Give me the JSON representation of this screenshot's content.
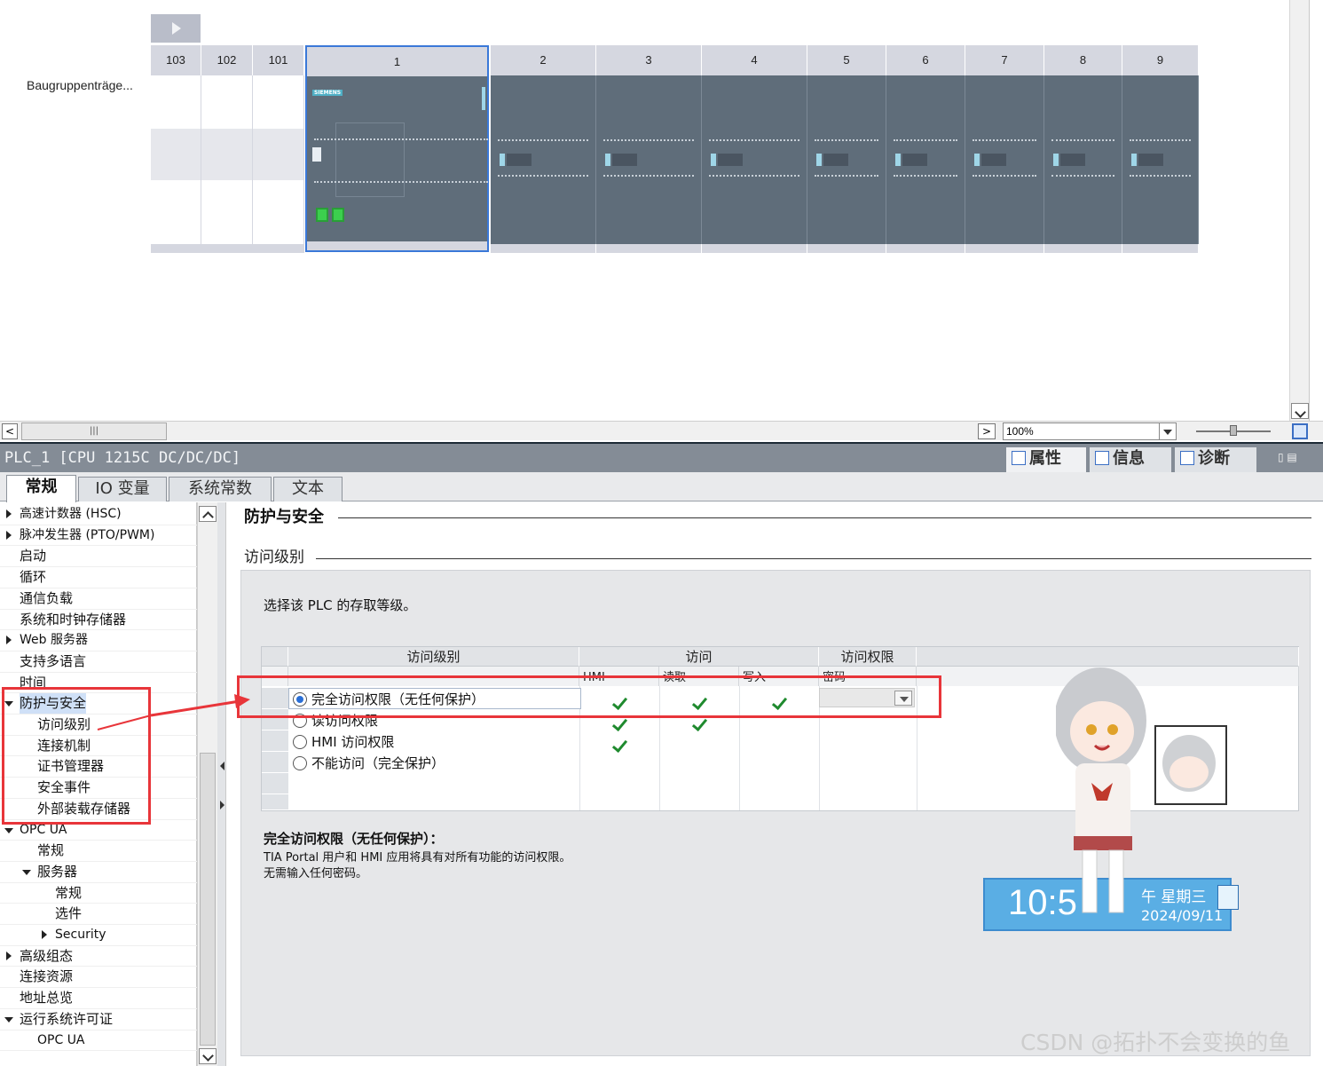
{
  "device_view": {
    "rack_label": "Baugruppenträge...",
    "slots": [
      "103",
      "102",
      "101",
      "1",
      "2",
      "3",
      "4",
      "5",
      "6",
      "7",
      "8",
      "9"
    ],
    "cpu_brand": "SIEMENS",
    "zoom": "100%",
    "scroll_thumb": "|||"
  },
  "inspector": {
    "title": "PLC_1 [CPU 1215C DC/DC/DC]",
    "view_tabs": [
      "属性",
      "信息",
      "诊断"
    ],
    "tabs": [
      "常规",
      "IO 变量",
      "系统常数",
      "文本"
    ],
    "active_tab": "常规"
  },
  "nav": {
    "items": [
      {
        "label": "高速计数器 (HSC)",
        "level": 0,
        "toggle": "collapsed"
      },
      {
        "label": "脉冲发生器 (PTO/PWM)",
        "level": 0,
        "toggle": "collapsed"
      },
      {
        "label": "启动",
        "level": 0,
        "toggle": "none"
      },
      {
        "label": "循环",
        "level": 0,
        "toggle": "none"
      },
      {
        "label": "通信负载",
        "level": 0,
        "toggle": "none"
      },
      {
        "label": "系统和时钟存储器",
        "level": 0,
        "toggle": "none"
      },
      {
        "label": "Web 服务器",
        "level": 0,
        "toggle": "collapsed"
      },
      {
        "label": "支持多语言",
        "level": 0,
        "toggle": "none"
      },
      {
        "label": "时间",
        "level": 0,
        "toggle": "none"
      },
      {
        "label": "防护与安全",
        "level": 0,
        "toggle": "expanded"
      },
      {
        "label": "访问级别",
        "level": 1,
        "toggle": "none"
      },
      {
        "label": "连接机制",
        "level": 1,
        "toggle": "none"
      },
      {
        "label": "证书管理器",
        "level": 1,
        "toggle": "none"
      },
      {
        "label": "安全事件",
        "level": 1,
        "toggle": "none"
      },
      {
        "label": "外部装载存储器",
        "level": 1,
        "toggle": "none"
      },
      {
        "label": "OPC UA",
        "level": 0,
        "toggle": "expanded"
      },
      {
        "label": "常规",
        "level": 1,
        "toggle": "none"
      },
      {
        "label": "服务器",
        "level": 1,
        "toggle": "expanded"
      },
      {
        "label": "常规",
        "level": 2,
        "toggle": "none"
      },
      {
        "label": "选件",
        "level": 2,
        "toggle": "none"
      },
      {
        "label": "Security",
        "level": 2,
        "toggle": "collapsed"
      },
      {
        "label": "高级组态",
        "level": 0,
        "toggle": "collapsed"
      },
      {
        "label": "连接资源",
        "level": 0,
        "toggle": "none"
      },
      {
        "label": "地址总览",
        "level": 0,
        "toggle": "none"
      },
      {
        "label": "运行系统许可证",
        "level": 0,
        "toggle": "expanded"
      },
      {
        "label": "OPC UA",
        "level": 1,
        "toggle": "none"
      }
    ]
  },
  "content": {
    "section_title": "防护与安全",
    "subsection_title": "访问级别",
    "instruction": "选择该 PLC 的存取等级。",
    "grid": {
      "header_groups": [
        "访问级别",
        "访问",
        "访问权限"
      ],
      "subheaders": [
        "HMI",
        "读取",
        "写入",
        "密码"
      ],
      "rows": [
        {
          "label": "完全访问权限（无任何保护）",
          "selected": true,
          "hmi": true,
          "read": true,
          "write": true
        },
        {
          "label": "读访问权限",
          "selected": false,
          "hmi": true,
          "read": true,
          "write": false
        },
        {
          "label": "HMI 访问权限",
          "selected": false,
          "hmi": true,
          "read": false,
          "write": false
        },
        {
          "label": "不能访问（完全保护）",
          "selected": false,
          "hmi": false,
          "read": false,
          "write": false
        }
      ]
    },
    "description": {
      "title": "完全访问权限（无任何保护）：",
      "lines": [
        "TIA Portal 用户和 HMI 应用将具有对所有功能的访问权限。",
        "无需输入任何密码。"
      ]
    }
  },
  "overlay": {
    "clock_time": "10:5",
    "clock_day": "午 星期三",
    "clock_date": "2024/09/11",
    "watermark": "CSDN @拓扑不会变换的鱼",
    "annotation_color": "#e8353a"
  }
}
